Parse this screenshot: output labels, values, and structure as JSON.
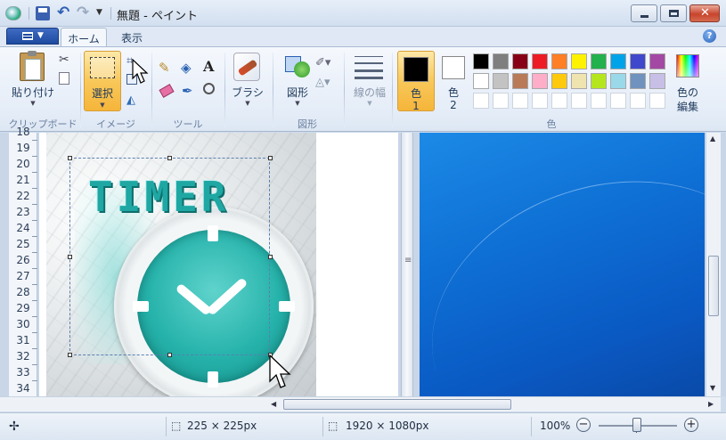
{
  "window": {
    "title": "無題 - ペイント"
  },
  "tabs": [
    {
      "label": "ホーム",
      "active": true
    },
    {
      "label": "表示",
      "active": false
    }
  ],
  "ribbon": {
    "clipboard": {
      "paste_label": "貼り付け",
      "group_label": "クリップボード"
    },
    "image": {
      "select_label": "選択",
      "group_label": "イメージ"
    },
    "tools": {
      "group_label": "ツール"
    },
    "brushes": {
      "label": "ブラシ"
    },
    "shapes": {
      "label": "図形",
      "group_label": "図形"
    },
    "size": {
      "label": "線の幅"
    },
    "colors": {
      "color1_label": "色",
      "color1_num": "1",
      "color2_label": "色",
      "color2_num": "2",
      "edit_label_1": "色の",
      "edit_label_2": "編集",
      "group_label": "色",
      "color1_value": "#000000",
      "color2_value": "#ffffff",
      "palette_row1": [
        "#000000",
        "#7f7f7f",
        "#880015",
        "#ed1c24",
        "#ff7f27",
        "#fff200",
        "#22b14c",
        "#00a2e8",
        "#3f48cc",
        "#a349a4"
      ],
      "palette_row2": [
        "#ffffff",
        "#c3c3c3",
        "#b97a57",
        "#ffaec9",
        "#ffc90e",
        "#efe4b0",
        "#b5e61d",
        "#99d9ea",
        "#7092be",
        "#c8bfe7"
      ],
      "palette_row3": [
        "#ffffff",
        "#ffffff",
        "#ffffff",
        "#ffffff",
        "#ffffff",
        "#ffffff",
        "#ffffff",
        "#ffffff",
        "#ffffff",
        "#ffffff"
      ]
    }
  },
  "ruler": {
    "rows": [
      "18",
      "19",
      "20",
      "21",
      "22",
      "23",
      "24",
      "25",
      "26",
      "27",
      "28",
      "29",
      "30",
      "31",
      "32",
      "33",
      "34"
    ]
  },
  "canvas": {
    "image_text": "TIMER",
    "accent_color": "#1fa7a3"
  },
  "status": {
    "selection_size": "225 × 225px",
    "image_size": "1920 × 1080px",
    "zoom": "100%"
  }
}
